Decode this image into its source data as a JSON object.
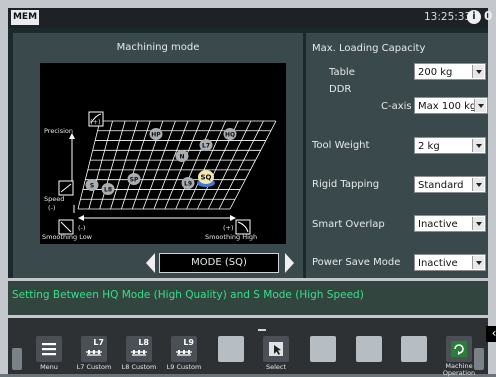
{
  "status": {
    "mode": "MEM",
    "time": "13:25:33",
    "alarm_icon": "i",
    "alarm_count": "0"
  },
  "left": {
    "title": "Machining mode",
    "axis": {
      "precision": "Precision",
      "precision_plus": "(+)",
      "speed": "Speed",
      "speed_minus": "(-)",
      "smoothing_low": "Smoothing Low",
      "smoothing_minus": "(-)",
      "smoothing_high": "Smoothing High",
      "smoothing_plus": "(+)"
    },
    "modes": [
      {
        "label": "HP",
        "selected": false
      },
      {
        "label": "HQ",
        "selected": false
      },
      {
        "label": "L7",
        "selected": false
      },
      {
        "label": "N",
        "selected": false
      },
      {
        "label": "SQ",
        "selected": true
      },
      {
        "label": "S",
        "selected": false
      },
      {
        "label": "L8",
        "selected": false
      },
      {
        "label": "SP",
        "selected": false
      },
      {
        "label": "L9",
        "selected": false
      }
    ],
    "mode_button": "MODE (SQ)"
  },
  "right": {
    "heading": "Max. Loading Capacity",
    "table_label": "Table",
    "table_value": "200 kg",
    "ddr_label": "DDR",
    "caxis_label": "C-axis",
    "caxis_value": "Max 100 kg",
    "tool_weight_label": "Tool Weight",
    "tool_weight_value": "2 kg",
    "rigid_tapping_label": "Rigid Tapping",
    "rigid_tapping_value": "Standard",
    "smart_overlap_label": "Smart Overlap",
    "smart_overlap_value": "Inactive",
    "power_save_label": "Power Save Mode",
    "power_save_value": "Inactive"
  },
  "message": "Setting Between HQ Mode (High Quality) and S Mode (High Speed)",
  "softkeys": [
    {
      "label": "Menu",
      "icon": "menu-icon"
    },
    {
      "label": "L7 Custom",
      "num": "L7",
      "icon": "custom-icon"
    },
    {
      "label": "L8 Custom",
      "num": "L8",
      "icon": "custom-icon"
    },
    {
      "label": "L9 Custom",
      "num": "L9",
      "icon": "custom-icon"
    },
    {
      "label": "Select",
      "icon": "select-icon"
    },
    {
      "label": "Machine Operation",
      "icon": "machine-operation-icon"
    }
  ],
  "colors": {
    "message_text": "#34e08a",
    "selected_mode": "#f4e6b0",
    "mode_dot": "#a8aeb3"
  }
}
